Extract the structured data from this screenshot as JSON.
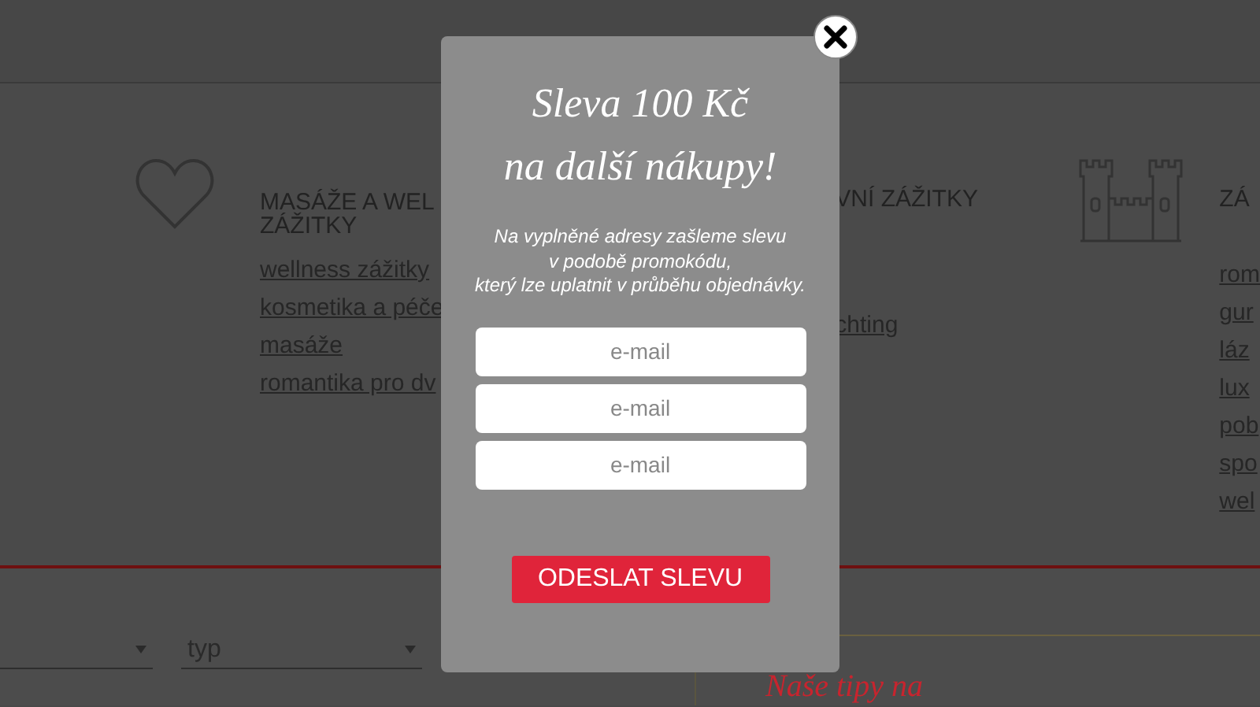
{
  "categories": [
    {
      "kind": "heart",
      "heading": [
        "MASÁŽE A WEL",
        "ZÁŽITKY"
      ],
      "links": [
        "wellness zážitky",
        "kosmetika a péče",
        "masáže",
        "romantika pro dv"
      ]
    },
    {
      "kind": "plain",
      "heading": [
        "VNÍ ZÁŽITKY"
      ],
      "links": [
        "chting"
      ]
    },
    {
      "kind": "castle",
      "heading": [
        "ZÁ"
      ],
      "links": [
        "rom",
        "gur",
        "láz",
        "lux",
        "pob",
        "spo",
        "wel"
      ]
    }
  ],
  "filters": [
    {
      "kind": "select"
    },
    {
      "kind": "select",
      "value": "typ"
    }
  ],
  "tips_heading": "Naše tipy na",
  "popup": {
    "title": [
      "Sleva 100 Kč",
      "na další nákupy!"
    ],
    "text": [
      "Na vyplněné adresy zašleme slevu",
      "v podobě promokódu,",
      "který lze uplatnit v průběhu objednávky."
    ],
    "inputs": [
      {
        "placeholder": "e-mail"
      },
      {
        "placeholder": "e-mail"
      },
      {
        "placeholder": "e-mail"
      }
    ],
    "button": "ODESLAT SLEVU"
  }
}
